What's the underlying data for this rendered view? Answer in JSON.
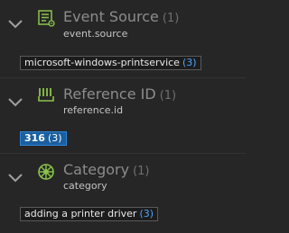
{
  "fields": [
    {
      "title": "Event Source",
      "count": "(1)",
      "key": "event.source",
      "icon": "list-document-icon",
      "value": {
        "label": "microsoft-windows-printservice",
        "count": "(3)"
      }
    },
    {
      "title": "Reference ID",
      "count": "(1)",
      "key": "reference.id",
      "icon": "barcode-id-icon",
      "value": {
        "label": "316",
        "count": "(3)"
      }
    },
    {
      "title": "Category",
      "count": "(1)",
      "key": "category",
      "icon": "category-wheel-icon",
      "value": {
        "label": "adding a printer driver",
        "count": "(3)"
      }
    }
  ],
  "colors": {
    "background": "#262626",
    "icon_green": "#8bc34a",
    "selected_chip": "#1a5fa0",
    "count_blue": "#4ea3ff"
  }
}
